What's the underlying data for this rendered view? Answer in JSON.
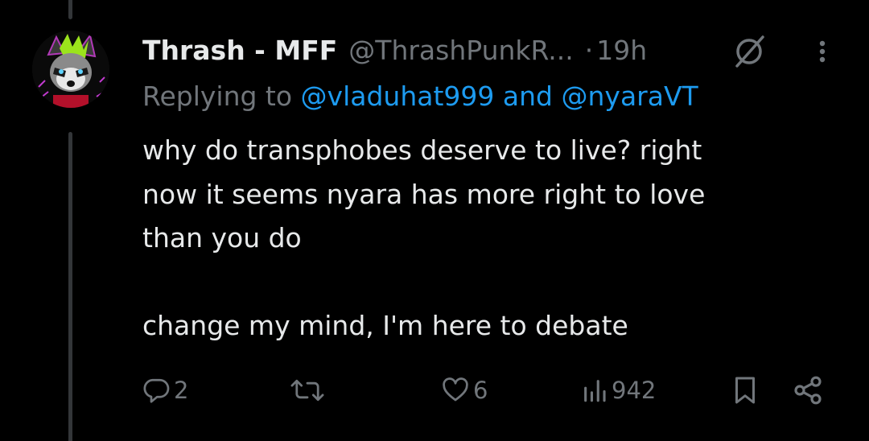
{
  "post": {
    "display_name": "Thrash - MFF",
    "handle": "@ThrashPunkR...",
    "separator": "·",
    "time": "19h",
    "reply_prefix": "Replying to",
    "reply_mention_1": "@vladuhat999",
    "reply_and": "and",
    "reply_mention_2": "@nyaraVT",
    "body_line_1": "why do transphobes deserve to live? right",
    "body_line_2": "now it seems nyara has more right to love",
    "body_line_3": "than you do",
    "body_line_4": "change my mind, I'm here to debate"
  },
  "actions": {
    "reply_count": "2",
    "repost_count": "",
    "like_count": "6",
    "view_count": "942"
  },
  "icons": {
    "reply": "reply-icon",
    "repost": "repost-icon",
    "like": "heart-icon",
    "views": "views-icon",
    "bookmark": "bookmark-icon",
    "share": "share-icon",
    "grok": "grok-icon",
    "more": "more-icon"
  },
  "colors": {
    "background": "#000000",
    "text": "#e7e9ea",
    "muted": "#71767b",
    "mention": "#1d9bf0",
    "thread_line": "#333639"
  }
}
